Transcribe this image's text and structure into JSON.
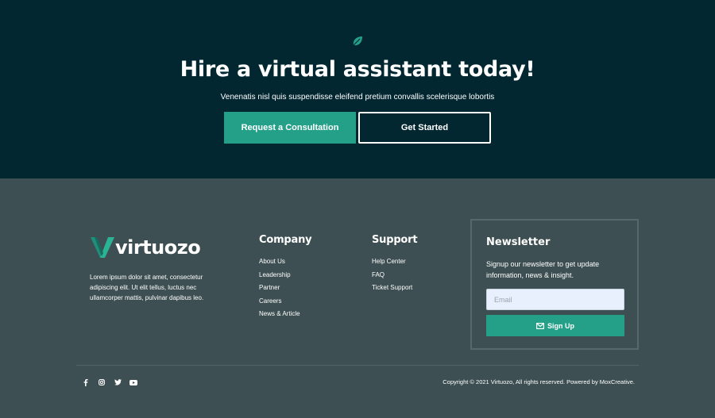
{
  "hero": {
    "title": "Hire a virtual assistant today!",
    "subtitle": "Venenatis nisl quis suspendisse eleifend pretium convallis scelerisque lobortis",
    "consult_label": "Request a Consultation",
    "start_label": "Get Started",
    "icon": "leaf-icon"
  },
  "brand": {
    "name": "virtuozo",
    "about": "Lorem ipsum dolor sit amet, consectetur adipiscing elit. Ut elit tellus, luctus nec ullamcorper mattis, pulvinar dapibus leo."
  },
  "company": {
    "title": "Company",
    "links": [
      "About Us",
      "Leadership",
      "Partner",
      "Careers",
      "News & Article"
    ]
  },
  "support": {
    "title": "Support",
    "links": [
      "Help Center",
      "FAQ",
      "Ticket Support"
    ]
  },
  "newsletter": {
    "title": "Newsletter",
    "text": "Signup our newsletter to get update information, news & insight.",
    "email_placeholder": "Email",
    "email_value": "",
    "button_label": "Sign Up"
  },
  "footer": {
    "social_icons": [
      "facebook-icon",
      "instagram-icon",
      "twitter-icon",
      "youtube-icon"
    ],
    "copyright": "Copyright © 2021 Virtuozo, All rights reserved. Powered by MoxCreative."
  },
  "colors": {
    "hero_bg": "#022731",
    "footer_bg": "#3d4f52",
    "accent": "#24a089"
  }
}
